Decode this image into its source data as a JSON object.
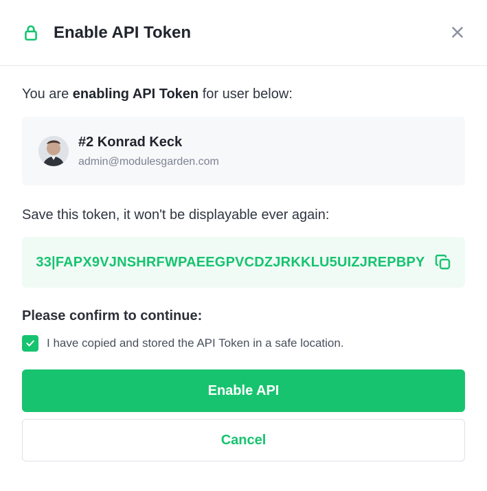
{
  "header": {
    "title": "Enable API Token",
    "icon": "lock-icon"
  },
  "body": {
    "lead_prefix": "You are ",
    "lead_bold": "enabling API Token",
    "lead_suffix": " for user below:",
    "user": {
      "name": "#2 Konrad Keck",
      "email": "admin@modulesgarden.com"
    },
    "save_notice": "Save this token, it won't be displayable ever again:",
    "token": "33|FAPX9VJNSHRFWPAEEGPVCDZJRKKLU5UIZJREPBPY",
    "confirm_title": "Please confirm to continue:",
    "checkbox_label": "I have copied and stored the API Token in a safe location.",
    "checkbox_checked": true
  },
  "actions": {
    "primary": "Enable API",
    "secondary": "Cancel"
  },
  "colors": {
    "accent": "#16c36f",
    "token_bg": "#f1fbf6",
    "card_bg": "#f7f8fa"
  }
}
